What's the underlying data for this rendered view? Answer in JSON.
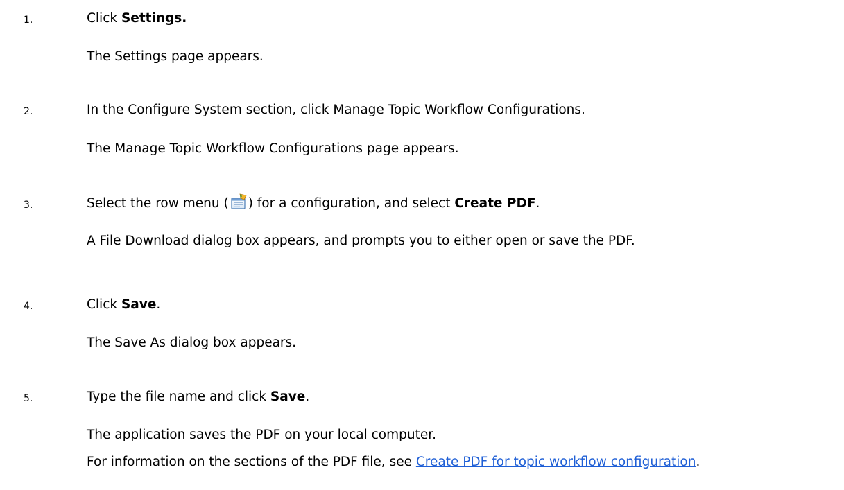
{
  "steps": [
    {
      "num": "1.",
      "action": {
        "pre": "Click ",
        "strong": "Settings."
      },
      "result": "The Settings page appears."
    },
    {
      "num": "2.",
      "action_text": "In the Configure System section, click Manage Topic Workflow Configurations.",
      "result": "The Manage Topic Workflow Configurations page appears."
    },
    {
      "num": "3.",
      "action": {
        "pre": "Select the row menu (",
        "icon": "row-menu-icon",
        "mid": ") for a configuration, and select ",
        "strong": "Create PDF",
        "post": "."
      },
      "result": "A File Download dialog box appears, and prompts you to either open or save the PDF."
    },
    {
      "num": "4.",
      "action": {
        "pre": "Click ",
        "strong": "Save",
        "post": "."
      },
      "result": "The Save As dialog box appears."
    },
    {
      "num": "5.",
      "action": {
        "pre": "Type the file name and click ",
        "strong": "Save",
        "post": "."
      },
      "result": "The application saves the PDF on your local computer.",
      "note": {
        "pre": "For information on the sections of the PDF file, see ",
        "link": "Create PDF for topic workflow configuration",
        "post": "."
      }
    }
  ]
}
